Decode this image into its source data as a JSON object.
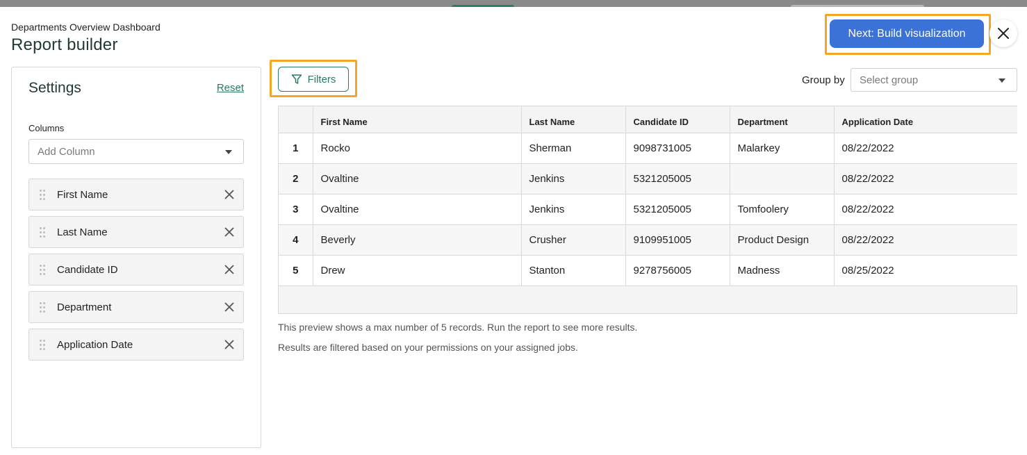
{
  "header": {
    "subtitle": "Departments Overview Dashboard",
    "title": "Report builder",
    "next_label": "Next: Build visualization"
  },
  "settings": {
    "title": "Settings",
    "reset_label": "Reset",
    "columns_label": "Columns",
    "add_column_placeholder": "Add Column",
    "columns": [
      {
        "label": "First Name"
      },
      {
        "label": "Last Name"
      },
      {
        "label": "Candidate ID"
      },
      {
        "label": "Department"
      },
      {
        "label": "Application Date"
      }
    ]
  },
  "toolbar": {
    "filters_label": "Filters",
    "group_by_label": "Group by",
    "group_placeholder": "Select group"
  },
  "table": {
    "headers": [
      "",
      "First Name",
      "Last Name",
      "Candidate ID",
      "Department",
      "Application Date"
    ],
    "rows": [
      [
        "1",
        "Rocko",
        "Sherman",
        "9098731005",
        "Malarkey",
        "08/22/2022"
      ],
      [
        "2",
        "Ovaltine",
        "Jenkins",
        "5321205005",
        "",
        "08/22/2022"
      ],
      [
        "3",
        "Ovaltine",
        "Jenkins",
        "5321205005",
        "Tomfoolery",
        "08/22/2022"
      ],
      [
        "4",
        "Beverly",
        "Crusher",
        "9109951005",
        "Product Design",
        "08/22/2022"
      ],
      [
        "5",
        "Drew",
        "Stanton",
        "9278756005",
        "Madness",
        "08/25/2022"
      ]
    ]
  },
  "notes": {
    "preview": "This preview shows a max number of 5 records. Run the report to see more results.",
    "permissions": "Results are filtered based on your permissions on your assigned jobs."
  },
  "colors": {
    "primary_button": "#3a72d8",
    "accent_green": "#2a7a5b",
    "highlight_outline": "#f5a623"
  },
  "icons": [
    "close-icon",
    "filter-icon",
    "chevron-down-icon",
    "drag-handle-icon",
    "remove-icon"
  ]
}
